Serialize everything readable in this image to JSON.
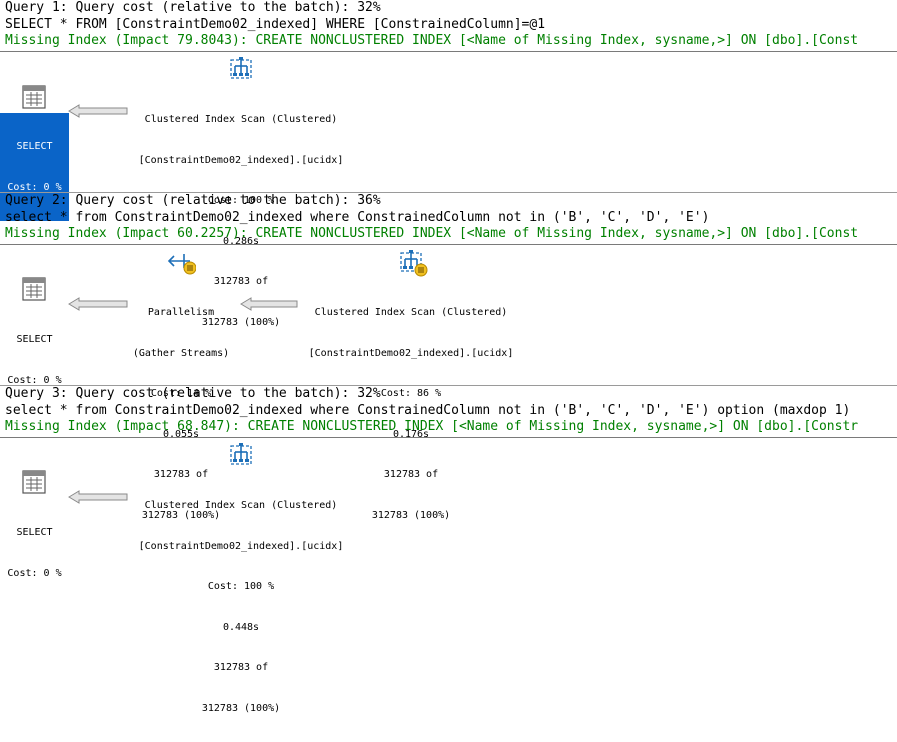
{
  "queries": [
    {
      "header": "Query 1: Query cost (relative to the batch): 32%",
      "sql": "SELECT * FROM [ConstraintDemo02_indexed] WHERE [ConstrainedColumn]=@1",
      "missing_index": "Missing Index (Impact 79.8043): CREATE NONCLUSTERED INDEX [<Name of Missing Index, sysname,>] ON [dbo].[Const",
      "select": {
        "label": "SELECT",
        "cost": "Cost: 0 %",
        "selected": true
      },
      "ops": [
        {
          "name": "Clustered Index Scan (Clustered)",
          "object": "[ConstraintDemo02_indexed].[ucidx]",
          "cost": "Cost: 100 %",
          "time": "0.286s",
          "rows": "312783 of",
          "estimate": "312783 (100%)",
          "icon": "clustered-index-scan-icon"
        }
      ]
    },
    {
      "header": "Query 2: Query cost (relative to the batch): 36%",
      "sql": "select * from ConstraintDemo02_indexed where ConstrainedColumn not in ('B', 'C', 'D', 'E')",
      "missing_index": "Missing Index (Impact 60.2257): CREATE NONCLUSTERED INDEX [<Name of Missing Index, sysname,>] ON [dbo].[Const",
      "select": {
        "label": "SELECT",
        "cost": "Cost: 0 %",
        "selected": false
      },
      "ops": [
        {
          "name": "Parallelism",
          "object": "(Gather Streams)",
          "cost": "Cost: 14 %",
          "time": "0.055s",
          "rows": "312783 of",
          "estimate": "312783 (100%)",
          "icon": "parallelism-icon"
        },
        {
          "name": "Clustered Index Scan (Clustered)",
          "object": "[ConstraintDemo02_indexed].[ucidx]",
          "cost": "Cost: 86 %",
          "time": "0.176s",
          "rows": "312783 of",
          "estimate": "312783 (100%)",
          "icon": "parallel-clustered-index-scan-icon"
        }
      ]
    },
    {
      "header": "Query 3: Query cost (relative to the batch): 32%",
      "sql": "select * from ConstraintDemo02_indexed where ConstrainedColumn not in ('B', 'C', 'D', 'E') option (maxdop 1)",
      "missing_index": "Missing Index (Impact 68.847): CREATE NONCLUSTERED INDEX [<Name of Missing Index, sysname,>] ON [dbo].[Constr",
      "select": {
        "label": "SELECT",
        "cost": "Cost: 0 %",
        "selected": false
      },
      "ops": [
        {
          "name": "Clustered Index Scan (Clustered)",
          "object": "[ConstraintDemo02_indexed].[ucidx]",
          "cost": "Cost: 100 %",
          "time": "0.448s",
          "rows": "312783 of",
          "estimate": "312783 (100%)",
          "icon": "clustered-index-scan-icon"
        }
      ]
    }
  ],
  "colors": {
    "missing_index": "#008000",
    "selection": "#0a64c8",
    "icon_blue": "#1d6fb8",
    "parallel_badge": "#f0c020"
  }
}
